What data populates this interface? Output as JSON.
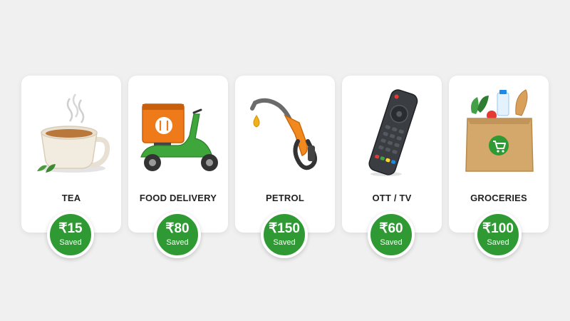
{
  "colors": {
    "background": "#f0f0f0",
    "card": "#ffffff",
    "badge": "#2f9a34"
  },
  "cards": [
    {
      "label": "TEA",
      "amount": "₹15",
      "saved": "Saved",
      "icon": "tea-cup-icon"
    },
    {
      "label": "FOOD DELIVERY",
      "amount": "₹80",
      "saved": "Saved",
      "icon": "delivery-scooter-icon"
    },
    {
      "label": "PETROL",
      "amount": "₹150",
      "saved": "Saved",
      "icon": "fuel-nozzle-icon"
    },
    {
      "label": "OTT / TV",
      "amount": "₹60",
      "saved": "Saved",
      "icon": "tv-remote-icon"
    },
    {
      "label": "GROCERIES",
      "amount": "₹100",
      "saved": "Saved",
      "icon": "grocery-bag-icon"
    }
  ]
}
